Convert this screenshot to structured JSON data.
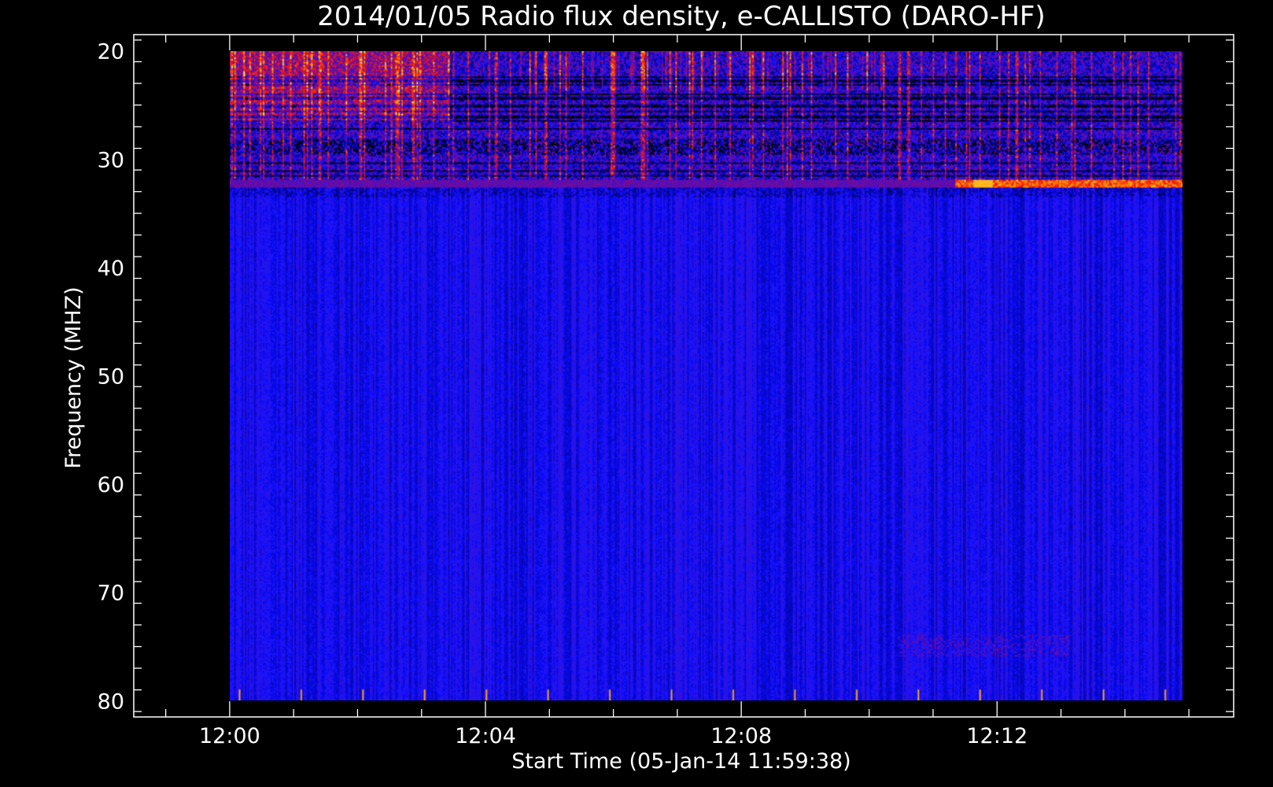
{
  "chart_data": {
    "type": "heatmap",
    "title": "2014/01/05  Radio flux density, e-CALLISTO (DARO-HF)",
    "xlabel": "Start Time (05-Jan-14 11:59:38)",
    "ylabel": "Frequency (MHZ)",
    "x_tick_labels": [
      "12:00",
      "12:04",
      "12:08",
      "12:12"
    ],
    "x_ticks_minutes": [
      0,
      4,
      8,
      12
    ],
    "x_range_minutes": [
      -1.5,
      15.7
    ],
    "data_x_range_minutes": [
      0,
      14.9
    ],
    "y_tick_labels": [
      "20",
      "30",
      "40",
      "50",
      "60",
      "70",
      "80"
    ],
    "y_ticks": [
      20,
      30,
      40,
      50,
      60,
      70,
      80
    ],
    "ylim": [
      18.5,
      81.5
    ],
    "data_y_range": [
      20,
      80
    ],
    "y_inverted": true,
    "grid": false,
    "colormap": [
      "#000000",
      "#0000ff",
      "#8a0d7a",
      "#ff2200",
      "#ff8c00",
      "#ffff80"
    ],
    "background_value_color": "#1a1aff",
    "features": [
      {
        "band_mhz": [
          20,
          33
        ],
        "description_value": "strong interference"
      },
      {
        "band_mhz": [
          31.8,
          32.6
        ],
        "description_value": "narrowband line"
      },
      {
        "band_mhz": [
          79,
          80
        ],
        "description_value": "periodic spikes"
      }
    ]
  }
}
